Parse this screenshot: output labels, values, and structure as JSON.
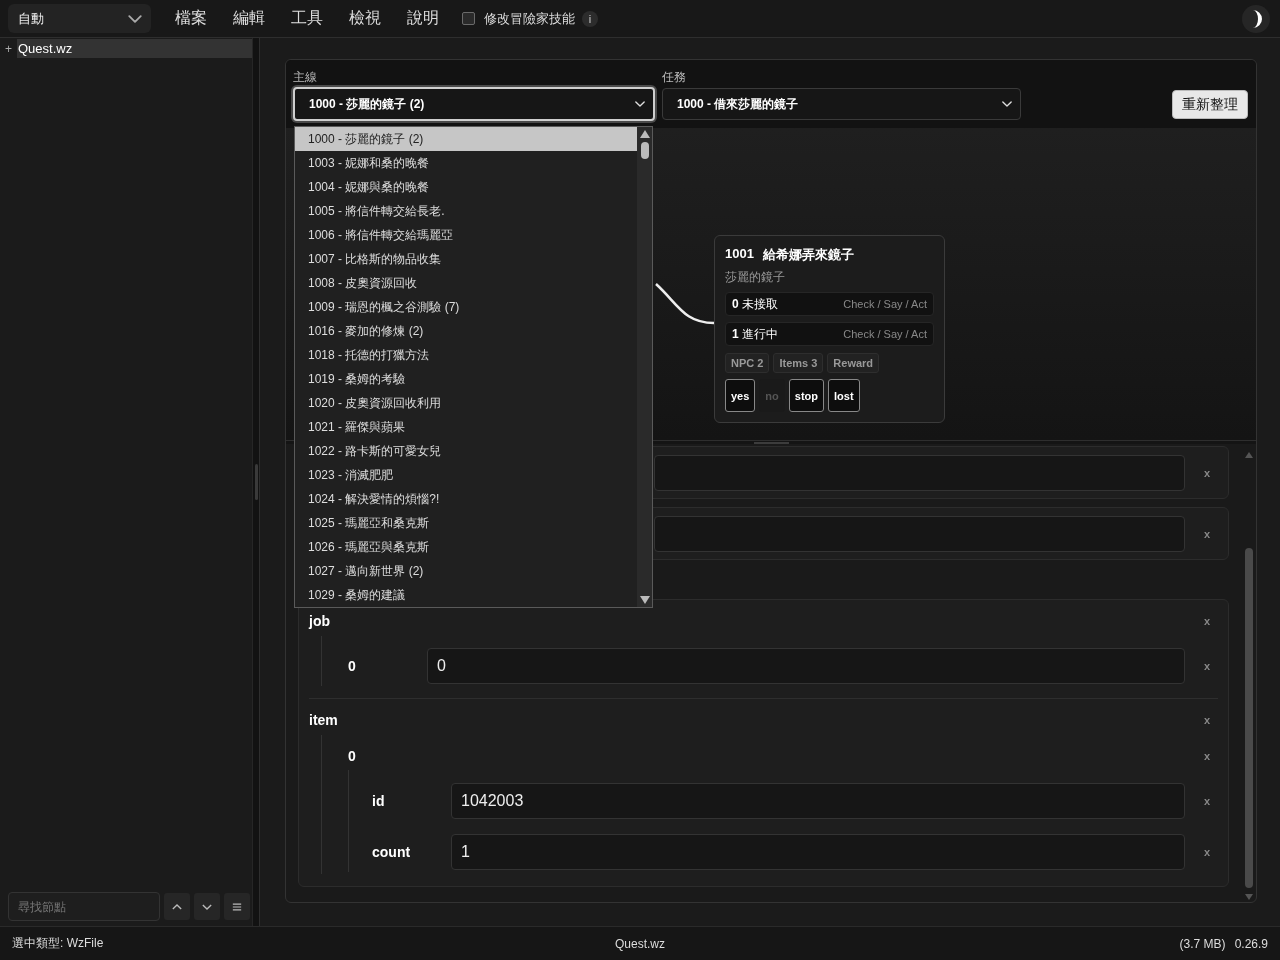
{
  "toolbar": {
    "mode_select": {
      "value": "自動"
    },
    "menu": [
      {
        "label": "檔案"
      },
      {
        "label": "編輯"
      },
      {
        "label": "工具"
      },
      {
        "label": "檢視"
      },
      {
        "label": "說明"
      }
    ],
    "option": {
      "label": "修改冒險家技能",
      "checked": false
    },
    "info_badge": "i"
  },
  "sidebar": {
    "tree": [
      {
        "expander": "+",
        "label": "Quest.wz",
        "selected": true
      }
    ],
    "search": {
      "placeholder": "尋找節點"
    }
  },
  "editor": {
    "main_line": {
      "label": "主線",
      "value": "1000 - 莎麗的鏡子 (2)",
      "focused": true,
      "expanded": true,
      "options": [
        {
          "text": "1000 - 莎麗的鏡子 (2)",
          "selected": true
        },
        {
          "text": "1003 - 妮娜和桑的晚餐",
          "selected": false
        },
        {
          "text": "1004 - 妮娜與桑的晚餐",
          "selected": false
        },
        {
          "text": "1005 - 將信件轉交給長老.",
          "selected": false
        },
        {
          "text": "1006 - 將信件轉交給瑪麗亞",
          "selected": false
        },
        {
          "text": "1007 - 比格斯的物品收集",
          "selected": false
        },
        {
          "text": "1008 - 皮奧資源回收",
          "selected": false
        },
        {
          "text": "1009 - 瑞恩的楓之谷測驗 (7)",
          "selected": false
        },
        {
          "text": "1016 - 麥加的修煉 (2)",
          "selected": false
        },
        {
          "text": "1018 - 托德的打獵方法",
          "selected": false
        },
        {
          "text": "1019 - 桑姆的考驗",
          "selected": false
        },
        {
          "text": "1020 - 皮奧資源回收利用",
          "selected": false
        },
        {
          "text": "1021 - 羅傑與蘋果",
          "selected": false
        },
        {
          "text": "1022 - 路卡斯的可愛女兒",
          "selected": false
        },
        {
          "text": "1023 - 消滅肥肥",
          "selected": false
        },
        {
          "text": "1024 - 解決愛情的煩惱?!",
          "selected": false
        },
        {
          "text": "1025 - 瑪麗亞和桑克斯",
          "selected": false
        },
        {
          "text": "1026 - 瑪麗亞與桑克斯",
          "selected": false
        },
        {
          "text": "1027 - 邁向新世界 (2)",
          "selected": false
        },
        {
          "text": "1029 - 桑姆的建議",
          "selected": false
        }
      ]
    },
    "quest": {
      "label": "任務",
      "value": "1000 - 借來莎麗的鏡子"
    },
    "refresh_button": "重新整理",
    "graph": {
      "nodes": [
        {
          "id": "1001",
          "title": "給希娜弄來鏡子",
          "subtitle": "莎麗的鏡子",
          "states": [
            {
              "index": "0",
              "label": "未接取",
              "hint": "Check / Say / Act"
            },
            {
              "index": "1",
              "label": "進行中",
              "hint": "Check / Say / Act"
            }
          ],
          "tags": [
            "NPC 2",
            "Items 3",
            "Reward"
          ],
          "outcomes": [
            {
              "label": "yes",
              "disabled": false
            },
            {
              "label": "no",
              "disabled": true
            },
            {
              "label": "stop",
              "disabled": false
            },
            {
              "label": "lost",
              "disabled": false
            }
          ]
        }
      ]
    },
    "form": {
      "cards": [
        {
          "children": [
            {
              "kind": "field",
              "remove": "x"
            }
          ]
        },
        {
          "children": [
            {
              "kind": "field",
              "remove": "x"
            }
          ]
        },
        {
          "children": [
            {
              "kind": "group",
              "name": "job",
              "remove": "x",
              "children": [
                {
                  "kind": "field",
                  "name": "0",
                  "value": "0",
                  "remove": "x"
                }
              ]
            },
            {
              "kind": "group",
              "name": "item",
              "remove": "x",
              "children": [
                {
                  "kind": "group",
                  "name": "0",
                  "remove": "x",
                  "children": [
                    {
                      "kind": "field",
                      "name": "id",
                      "value": "1042003",
                      "remove": "x"
                    },
                    {
                      "kind": "field",
                      "name": "count",
                      "value": "1",
                      "remove": "x"
                    }
                  ]
                }
              ]
            }
          ]
        }
      ]
    }
  },
  "status_bar": {
    "selection": "選中類型: WzFile",
    "file": "Quest.wz",
    "size": "(3.7 MB)",
    "version": "0.26.9"
  }
}
